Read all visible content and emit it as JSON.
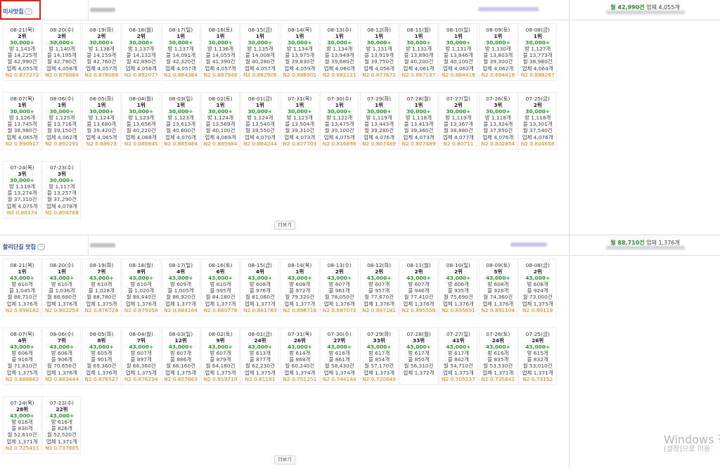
{
  "colors": {
    "green": "#2e9a2e",
    "orange": "#e07d12",
    "keyword": "#2a4db0",
    "highlight": "#e02020"
  },
  "sections": [
    {
      "keyword": "미사맛집",
      "summary_volume": "월 42,990건",
      "summary_count": "업체 4,055개",
      "more_label": "더보기",
      "cells": [
        {
          "date": "08-21(목)",
          "rank": "2위",
          "vol": "30,000+",
          "bang": "방 1,143개",
          "bl": "블 14,225개",
          "mon": "월 42,990건",
          "biz": "업체 4,055개",
          "n2": "N2 0.877272"
        },
        {
          "date": "08-20(수)",
          "rank": "2위",
          "vol": "30,000+",
          "bang": "방 1,140개",
          "bl": "블 14,195개",
          "mon": "월 42,790건",
          "biz": "업체 4,058개",
          "n2": "N2 0.876884"
        },
        {
          "date": "08-19(화)",
          "rank": "2위",
          "vol": "30,000+",
          "bang": "방 1,138개",
          "bl": "블 14,159개",
          "mon": "월 42,760건",
          "biz": "업체 4,057개",
          "n2": "N2 0.878068"
        },
        {
          "date": "08-18(월)",
          "rank": "2위",
          "vol": "30,000+",
          "bang": "방 1,137개",
          "bl": "블 14,132개",
          "mon": "월 42,890건",
          "biz": "업체 4,058개",
          "n2": "N2 0.882077"
        },
        {
          "date": "08-17(일)",
          "rank": "1위",
          "vol": "30,000+",
          "bang": "방 1,137개",
          "bl": "블 14,091개",
          "mon": "월 42,320건",
          "biz": "업체 4,057개",
          "n2": "N2 0.884384"
        },
        {
          "date": "08-16(토)",
          "rank": "1위",
          "vol": "30,000+",
          "bang": "방 1,136개",
          "bl": "블 14,055개",
          "mon": "월 41,390건",
          "biz": "업체 4,057개",
          "n2": "N2 0.887948"
        },
        {
          "date": "08-15(금)",
          "rank": "1위",
          "vol": "30,000+",
          "bang": "방 1,135개",
          "bl": "블 14,009개",
          "mon": "월 40,280건",
          "biz": "업체 4,057개",
          "n2": "N2 0.882906"
        },
        {
          "date": "08-14(목)",
          "rank": "1위",
          "vol": "30,000+",
          "bang": "방 1,134개",
          "bl": "블 13,975개",
          "mon": "월 39,830건",
          "biz": "업체 4,059개",
          "n2": "N2 0.886901"
        },
        {
          "date": "08-13(수)",
          "rank": "1위",
          "vol": "30,000+",
          "bang": "방 1,134개",
          "bl": "블 13,949개",
          "mon": "월 39,680건",
          "biz": "업체 4,060개",
          "n2": "N2 0.882121"
        },
        {
          "date": "08-12(화)",
          "rank": "1위",
          "vol": "30,000+",
          "bang": "방 1,131개",
          "bl": "블 13,919개",
          "mon": "월 39,750건",
          "biz": "업체 4,058개",
          "n2": "N2 0.877671"
        },
        {
          "date": "08-11(월)",
          "rank": "1위",
          "vol": "30,000+",
          "bang": "방 1,131개",
          "bl": "블 13,890개",
          "mon": "월 40,200건",
          "biz": "업체 4,061개",
          "n2": "N2 0.887187"
        },
        {
          "date": "08-10(일)",
          "rank": "1위",
          "vol": "30,000+",
          "bang": "방 1,131개",
          "bl": "블 13,846개",
          "mon": "월 40,100건",
          "biz": "업체 4,062개",
          "n2": "N2 0.884418"
        },
        {
          "date": "08-09(토)",
          "rank": "1위",
          "vol": "30,000+",
          "bang": "방 1,130개",
          "bl": "블 13,803개",
          "mon": "월 39,300건",
          "biz": "업체 4,062개",
          "n2": "N2 0.884418"
        },
        {
          "date": "08-08(금)",
          "rank": "1위",
          "vol": "30,000+",
          "bang": "방 1,127개",
          "bl": "블 13,773개",
          "mon": "월 38,980건",
          "biz": "업체 4,064개",
          "n2": "N2 0.888267"
        },
        {
          "date": "08-07(목)",
          "rank": "1위",
          "vol": "30,000+",
          "bang": "방 1,126개",
          "bl": "블 13,745개",
          "mon": "월 38,980건",
          "biz": "업체 4,065개",
          "n2": "N2 0.890917"
        },
        {
          "date": "08-06(수)",
          "rank": "1위",
          "vol": "30,000+",
          "bang": "방 1,125개",
          "bl": "블 13,716개",
          "mon": "월 39,150건",
          "biz": "업체 4,062개",
          "n2": "N2 0.892291"
        },
        {
          "date": "08-05(화)",
          "rank": "1위",
          "vol": "30,000+",
          "bang": "방 1,124개",
          "bl": "블 13,680개",
          "mon": "월 39,420건",
          "biz": "업체 4,065개",
          "n2": "N2 0.88673"
        },
        {
          "date": "08-04(월)",
          "rank": "1위",
          "vol": "30,000+",
          "bang": "방 1,123개",
          "bl": "블 13,656개",
          "mon": "월 40,220건",
          "biz": "업체 4,068개",
          "n2": "N2 0.885945"
        },
        {
          "date": "08-03(일)",
          "rank": "1위",
          "vol": "30,000+",
          "bang": "방 1,123개",
          "bl": "블 13,613개",
          "mon": "월 40,600건",
          "biz": "업체 4,070개",
          "n2": "N2 0.885984"
        },
        {
          "date": "08-02(토)",
          "rank": "1위",
          "vol": "30,000+",
          "bang": "방 1,124개",
          "bl": "블 13,569개",
          "mon": "월 40,100건",
          "biz": "업체 4,069개",
          "n2": "N2 0.885984"
        },
        {
          "date": "08-01(금)",
          "rank": "1위",
          "vol": "30,000+",
          "bang": "방 1,124개",
          "bl": "블 13,540개",
          "mon": "월 39,550건",
          "biz": "업체 4,070개",
          "n2": "N2 0.884244"
        },
        {
          "date": "07-31(목)",
          "rank": "1위",
          "vol": "30,000+",
          "bang": "방 1,123개",
          "bl": "블 13,504개",
          "mon": "월 39,310건",
          "biz": "업체 4,073개",
          "n2": "N2 0.827703"
        },
        {
          "date": "07-30(수)",
          "rank": "1위",
          "vol": "30,000+",
          "bang": "방 1,122개",
          "bl": "블 13,475개",
          "mon": "월 39,100건",
          "biz": "업체 4,075개",
          "n2": "N2 0.816898"
        },
        {
          "date": "07-29(화)",
          "rank": "1위",
          "vol": "30,000+",
          "bang": "방 1,119개",
          "bl": "블 13,443개",
          "mon": "월 39,280건",
          "biz": "업체 4,076개",
          "n2": "N2 0.807489"
        },
        {
          "date": "07-28(월)",
          "rank": "1위",
          "vol": "30,000+",
          "bang": "방 1,118개",
          "bl": "블 13,413개",
          "mon": "월 39,360건",
          "biz": "업체 4,073개",
          "n2": "N2 0.807489"
        },
        {
          "date": "07-27(일)",
          "rank": "2위",
          "vol": "30,000+",
          "bang": "방 1,119개",
          "bl": "블 13,367개",
          "mon": "월 38,880건",
          "biz": "업체 4,077개",
          "n2": "N2 0.80711"
        },
        {
          "date": "07-26(토)",
          "rank": "3위",
          "vol": "30,000+",
          "bang": "방 1,118개",
          "bl": "블 13,324개",
          "mon": "월 37,950건",
          "biz": "업체 4,076개",
          "n2": "N2 0.802854"
        },
        {
          "date": "07-25(금)",
          "rank": "2위",
          "vol": "30,000+",
          "bang": "방 1,118개",
          "bl": "블 13,301개",
          "mon": "월 37,540건",
          "biz": "업체 4,076개",
          "n2": "N2 0.804658"
        },
        {
          "date": "07-24(목)",
          "rank": "3위",
          "vol": "30,000+",
          "bang": "방 1,119개",
          "bl": "블 13,274개",
          "mon": "월 37,310건",
          "biz": "업체 4,075개",
          "n2": "N2 0.80174"
        },
        {
          "date": "07-23(수)",
          "rank": "3위",
          "vol": "30,000+",
          "bang": "방 1,117개",
          "bl": "블 13,257개",
          "mon": "월 37,290건",
          "biz": "업체 4,078개",
          "n2": "N2 0.804768"
        }
      ]
    },
    {
      "keyword": "할리단길 맛집",
      "summary_volume": "월 88,710건",
      "summary_count": "업체 1,376개",
      "more_label": "더보기",
      "cells": [
        {
          "date": "08-21(목)",
          "rank": "1위",
          "vol": "43,000+",
          "bang": "방 610개",
          "bl": "블 1,045개",
          "mon": "월 88,710건",
          "biz": "업체 1,376개",
          "n2": "N2 0.898182"
        },
        {
          "date": "08-20(수)",
          "rank": "1위",
          "vol": "43,000+",
          "bang": "방 610개",
          "bl": "블 1,036개",
          "mon": "월 88,680건",
          "biz": "업체 1,376개",
          "n2": "N2 0.902254"
        },
        {
          "date": "08-19(화)",
          "rank": "7위",
          "vol": "43,000+",
          "bang": "방 610개",
          "bl": "블 1,028개",
          "mon": "월 88,780건",
          "biz": "업체 1,375개",
          "n2": "N2 0.876724"
        },
        {
          "date": "08-18(월)",
          "rank": "8위",
          "vol": "43,000+",
          "bang": "방 610개",
          "bl": "블 1,020개",
          "mon": "월 88,440건",
          "biz": "업체 1,376개",
          "n2": "N2 0.879358"
        },
        {
          "date": "08-17(일)",
          "rank": "4위",
          "vol": "43,000+",
          "bang": "방 609개",
          "bl": "블 1,005개",
          "mon": "월 86,920건",
          "biz": "업체 1,377개",
          "n2": "N2 0.884164"
        },
        {
          "date": "08-16(토)",
          "rank": "6위",
          "vol": "43,000+",
          "bang": "방 610개",
          "bl": "블 995개",
          "mon": "월 84,180건",
          "biz": "업체 1,377개",
          "n2": "N2 0.880778"
        },
        {
          "date": "08-15(금)",
          "rank": "4위",
          "vol": "43,000+",
          "bang": "방 608개",
          "bl": "블 976개",
          "mon": "월 81,060건",
          "biz": "업체 1,377개",
          "n2": "N2 0.881783"
        },
        {
          "date": "08-14(목)",
          "rank": "1위",
          "vol": "43,000+",
          "bang": "방 608개",
          "bl": "블 972개",
          "mon": "월 79,320건",
          "biz": "업체 1,377개",
          "n2": "N2 0.898716"
        },
        {
          "date": "08-13(수)",
          "rank": "2위",
          "vol": "43,000+",
          "bang": "방 607개",
          "bl": "블 961개",
          "mon": "월 78,050건",
          "biz": "업체 1,376개",
          "n2": "N2 0.897072"
        },
        {
          "date": "08-12(화)",
          "rank": "2위",
          "vol": "43,000+",
          "bang": "방 607개",
          "bl": "블 957개",
          "mon": "월 77,670건",
          "biz": "업체 1,376개",
          "n2": "N2 0.897181"
        },
        {
          "date": "08-11(월)",
          "rank": "2위",
          "vol": "43,000+",
          "bang": "방 607개",
          "bl": "블 946개",
          "mon": "월 77,410건",
          "biz": "업체 1,376개",
          "n2": "N2 0.895558"
        },
        {
          "date": "08-10(일)",
          "rank": "2위",
          "vol": "43,000+",
          "bang": "방 606개",
          "bl": "블 935개",
          "mon": "월 75,690건",
          "biz": "업체 1,376개",
          "n2": "N2 0.895691"
        },
        {
          "date": "08-09(토)",
          "rank": "5위",
          "vol": "43,000+",
          "bang": "방 608개",
          "bl": "블 928개",
          "mon": "월 74,360건",
          "biz": "업체 1,376개",
          "n2": "N2 0.891104"
        },
        {
          "date": "08-08(금)",
          "rank": "2위",
          "vol": "43,000+",
          "bang": "방 608개",
          "bl": "블 924개",
          "mon": "월 73,000건",
          "biz": "업체 1,375개",
          "n2": "N2 0.89119"
        },
        {
          "date": "08-07(목)",
          "rank": "4위",
          "vol": "43,000+",
          "bang": "방 606개",
          "bl": "블 916개",
          "mon": "월 71,810건",
          "biz": "업체 1,375개",
          "n2": "N2 0.888662"
        },
        {
          "date": "08-06(수)",
          "rank": "7위",
          "vol": "43,000+",
          "bang": "방 606개",
          "bl": "블 906개",
          "mon": "월 70,650건",
          "biz": "업체 1,376개",
          "n2": "N2 0.883444"
        },
        {
          "date": "08-05(화)",
          "rank": "8위",
          "vol": "43,000+",
          "bang": "방 605개",
          "bl": "블 901개",
          "mon": "월 69,360건",
          "biz": "업체 1,376개",
          "n2": "N2 0.876527"
        },
        {
          "date": "08-04(월)",
          "rank": "7위",
          "vol": "43,000+",
          "bang": "방 607개",
          "bl": "블 897개",
          "mon": "월 68,360건",
          "biz": "업체 1,375개",
          "n2": "N2 0.876234"
        },
        {
          "date": "08-03(일)",
          "rank": "12위",
          "vol": "43,000+",
          "bang": "방 607개",
          "bl": "블 886개",
          "mon": "월 66,160건",
          "biz": "업체 1,375개",
          "n2": "N2 0.857663"
        },
        {
          "date": "08-02(토)",
          "rank": "9위",
          "vol": "43,000+",
          "bang": "방 607개",
          "bl": "블 879개",
          "mon": "월 64,180건",
          "biz": "업체 1,375개",
          "n2": "N2 0.859718"
        },
        {
          "date": "08-01(금)",
          "rank": "24위",
          "vol": "43,000+",
          "bang": "방 613개",
          "bl": "블 877개",
          "mon": "월 62,230건",
          "biz": "업체 1,375개",
          "n2": "N2 0.81181"
        },
        {
          "date": "07-31(목)",
          "rank": "26위",
          "vol": "43,000+",
          "bang": "방 614개",
          "bl": "블 868개",
          "mon": "월 60,240건",
          "biz": "업체 1,374개",
          "n2": "N2 0.751251"
        },
        {
          "date": "07-30(수)",
          "rank": "27위",
          "vol": "43,000+",
          "bang": "방 616개",
          "bl": "블 861개",
          "mon": "월 58,430건",
          "biz": "업체 1,374개",
          "n2": "N2 0.744144"
        },
        {
          "date": "07-29(화)",
          "rank": "33위",
          "vol": "43,000+",
          "bang": "방 617개",
          "bl": "블 854개",
          "mon": "월 57,170건",
          "biz": "업체 1,373개",
          "n2": "N2 0.720649"
        },
        {
          "date": "07-28(월)",
          "rank": "33위",
          "vol": "43,000+",
          "bang": "방 617개",
          "bl": "블 850개",
          "mon": "월 56,310건",
          "biz": "업체 1,372개",
          "n2": ""
        },
        {
          "date": "07-27(일)",
          "rank": "41위",
          "vol": "43,000+",
          "bang": "방 617개",
          "bl": "블 842개",
          "mon": "월 54,710건",
          "biz": "업체 1,371개",
          "n2": "N2 0.705137"
        },
        {
          "date": "07-26(토)",
          "rank": "24위",
          "vol": "43,000+",
          "bang": "방 616개",
          "bl": "블 835개",
          "mon": "월 53,530건",
          "biz": "업체 1,371개",
          "n2": "N2 0.735641"
        },
        {
          "date": "07-25(금)",
          "rank": "26위",
          "vol": "43,000+",
          "bang": "방 615개",
          "bl": "블 832개",
          "mon": "월 53,010건",
          "biz": "업체 1,371개",
          "n2": "N2 0.73152"
        },
        {
          "date": "07-24(목)",
          "rank": "28위",
          "vol": "43,000+",
          "bang": "방 616개",
          "bl": "블 830개",
          "mon": "월 52,610건",
          "biz": "업체 1,371개",
          "n2": "N2 0.725411"
        },
        {
          "date": "07-23(수)",
          "rank": "22위",
          "vol": "43,000+",
          "bang": "방 616개",
          "bl": "블 826개",
          "mon": "월 52,520건",
          "biz": "업체 1,371개",
          "n2": "N2 0.737685"
        }
      ]
    }
  ],
  "watermark": {
    "line1": "Windows 정",
    "line2": "[설정]으로 이동"
  }
}
